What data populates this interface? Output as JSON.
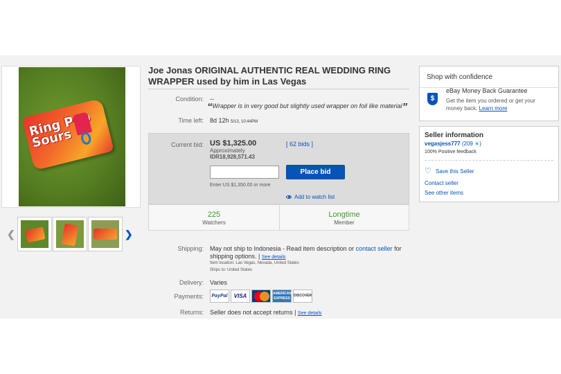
{
  "listing": {
    "title": "Joe Jonas ORIGINAL AUTHENTIC REAL WEDDING RING WRAPPER used by him in Las Vegas",
    "image_text": "Ring Pop Sours"
  },
  "details": {
    "condition_label": "Condition:",
    "condition_value": "--",
    "condition_quote": "Wrapper is in very good but slightly used wrapper on foil like material",
    "time_left_label": "Time left:",
    "time_left_value": "8d 12h",
    "time_left_end": "5/13, 10:44PM"
  },
  "bid": {
    "current_bid_label": "Current bid:",
    "price": "US $1,325.00",
    "approx_label": "Approximately",
    "approx_value": "IDR18,928,571.43",
    "bids_link": "[ 62 bids ]",
    "input_value": "",
    "place_bid_label": "Place bid",
    "enter_hint": "Enter US $1,350.00 or more",
    "watch_label": "Add to watch list"
  },
  "stats": {
    "watchers_count": "225",
    "watchers_label": "Watchers",
    "member_value": "Longtime",
    "member_label": "Member"
  },
  "shipping": {
    "label": "Shipping:",
    "text_a": "May not ship to Indonesia - Read item description or ",
    "contact_link": "contact seller",
    "text_b": " for",
    "text_c": "shipping options. | ",
    "see_details": "See details",
    "location": "Item location:  Las Vegas, Nevada, United States",
    "ships_to": "Ships to:  United States"
  },
  "delivery": {
    "label": "Delivery:",
    "value": "Varies"
  },
  "payments": {
    "label": "Payments:",
    "paypal": "PayPal",
    "visa": "VISA",
    "amex": "AMERICAN EXPRESS",
    "discover": "DISCOVER"
  },
  "returns": {
    "label": "Returns:",
    "value": "Seller does not accept returns | ",
    "see_details": "See details"
  },
  "confidence": {
    "title": "Shop with confidence",
    "mbg_title": "eBay Money Back Guarantee",
    "mbg_text": "Get the item you ordered or get your money back. ",
    "learn_more": "Learn more"
  },
  "seller": {
    "title": "Seller information",
    "name": "vegasjess777",
    "score_open": "(209 ",
    "score_close": ")",
    "feedback": "100% Positive feedback",
    "save": "Save this Seller",
    "contact": "Contact seller",
    "other_items": "See other items"
  }
}
